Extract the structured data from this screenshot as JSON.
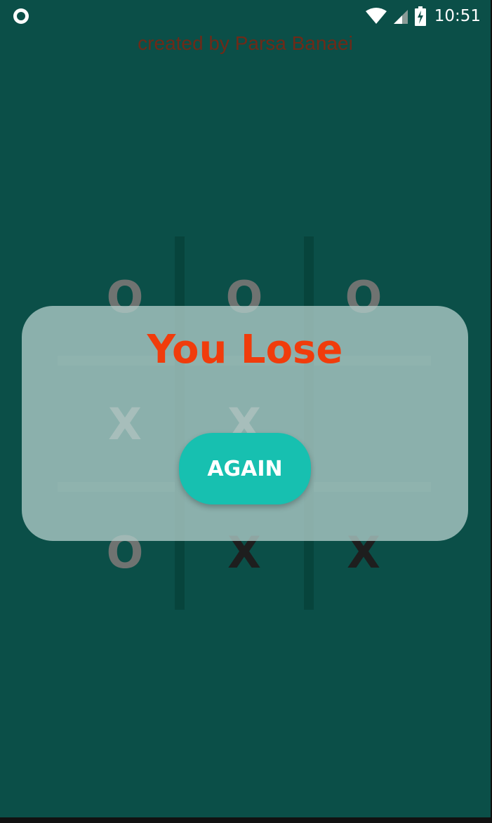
{
  "status_bar": {
    "time": "10:51",
    "icons": [
      "circle-notification-icon",
      "wifi-icon",
      "cellular-signal-icon",
      "battery-charging-icon"
    ]
  },
  "credit": "created by Parsa Banaei",
  "board": {
    "cells": [
      {
        "row": 1,
        "col": 1,
        "mark": "O"
      },
      {
        "row": 1,
        "col": 2,
        "mark": "O"
      },
      {
        "row": 1,
        "col": 3,
        "mark": "O"
      },
      {
        "row": 2,
        "col": 1,
        "mark": "X"
      },
      {
        "row": 2,
        "col": 2,
        "mark": "X"
      },
      {
        "row": 2,
        "col": 3,
        "mark": ""
      },
      {
        "row": 3,
        "col": 1,
        "mark": "O"
      },
      {
        "row": 3,
        "col": 2,
        "mark": "X"
      },
      {
        "row": 3,
        "col": 3,
        "mark": "X"
      }
    ]
  },
  "dialog": {
    "title": "You Lose",
    "button_label": "AGAIN"
  },
  "colors": {
    "background": "#0b4f48",
    "title": "#f03c0c",
    "button": "#17c0b0",
    "credit": "#6e2a18"
  }
}
